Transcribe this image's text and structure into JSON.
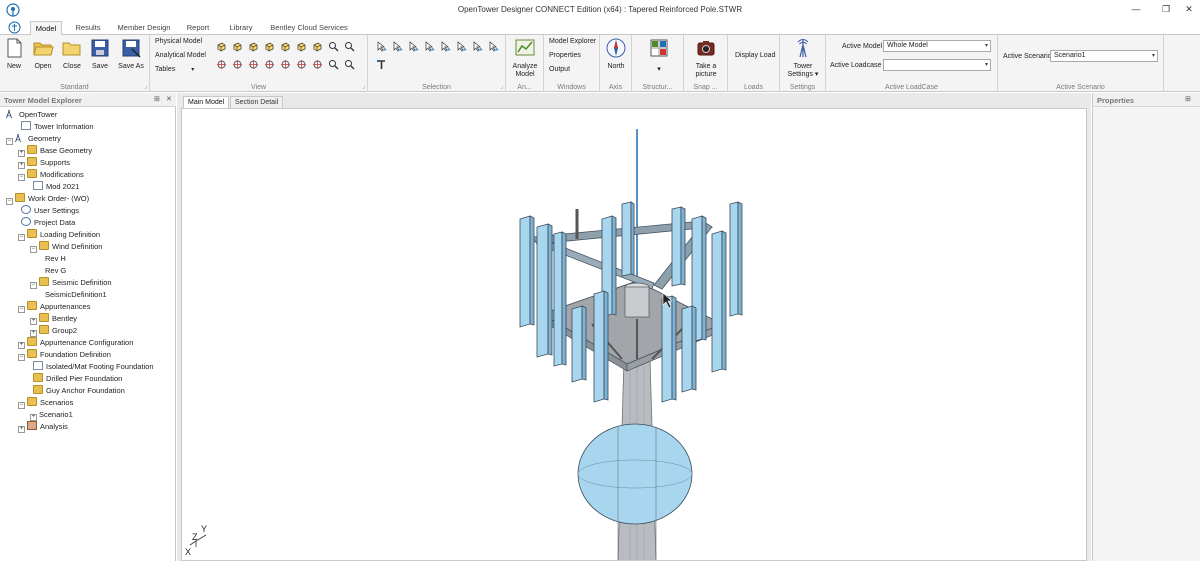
{
  "window": {
    "title": "OpenTower Designer CONNECT Edition (x64) : Tapered Reinforced Pole.STWR",
    "minimize": "—",
    "restore": "❐",
    "close": "✕"
  },
  "ribbon_tabs": [
    "Model",
    "Results",
    "Member Design",
    "Report",
    "Library",
    "Bentley Cloud Services"
  ],
  "standard": {
    "group_label": "Standard",
    "new": "New",
    "open": "Open",
    "close": "Close",
    "save": "Save",
    "save_as": "Save As"
  },
  "view": {
    "group_label": "View",
    "physical_model": "Physical Model",
    "analytical_model": "Analytical Model",
    "tables": "Tables"
  },
  "selection": {
    "group_label": "Selection"
  },
  "analyze": {
    "label": "Analyze Model",
    "group_label": "An..."
  },
  "windows": {
    "group_label": "Windows",
    "model_explorer": "Model Explorer",
    "properties": "Properties",
    "output": "Output"
  },
  "axis": {
    "north": "North",
    "group_label": "Axis"
  },
  "structure": {
    "group_label": "Structur..."
  },
  "snap": {
    "take_picture": "Take a picture",
    "group_label": "Snap ..."
  },
  "loads": {
    "display_load": "Display Load",
    "group_label": "Loads"
  },
  "settings": {
    "tower_settings": "Tower Settings",
    "group_label": "Settings"
  },
  "active_loadcase": {
    "group_label": "Active LoadCase",
    "active_model_label": "Active Model",
    "active_model_value": "Whole Model",
    "active_loadcase_label": "Active Loadcase",
    "active_loadcase_value": ""
  },
  "active_scenario": {
    "group_label": "Active Scenario",
    "label": "Active Scenario",
    "value": "Scenario1"
  },
  "explorer": {
    "title": "Tower Model Explorer",
    "items": [
      {
        "label": "OpenTower"
      },
      {
        "label": "Tower Information"
      },
      {
        "label": "Geometry"
      },
      {
        "label": "Base Geometry"
      },
      {
        "label": "Supports"
      },
      {
        "label": "Modifications"
      },
      {
        "label": "Mod 2021"
      },
      {
        "label": "Work Order- (WO)"
      },
      {
        "label": "User Settings"
      },
      {
        "label": "Project Data"
      },
      {
        "label": "Loading Definition"
      },
      {
        "label": "Wind Definition"
      },
      {
        "label": "Rev H"
      },
      {
        "label": "Rev G"
      },
      {
        "label": "Seismic Definition"
      },
      {
        "label": "SeismicDefinition1"
      },
      {
        "label": "Appurtenances"
      },
      {
        "label": "Bentley"
      },
      {
        "label": "Group2"
      },
      {
        "label": "Appurtenance Configuration"
      },
      {
        "label": "Foundation Definition"
      },
      {
        "label": "Isolated/Mat Footing Foundation"
      },
      {
        "label": "Drilled Pier Foundation"
      },
      {
        "label": "Guy Anchor Foundation"
      },
      {
        "label": "Scenarios"
      },
      {
        "label": "Scenario1"
      },
      {
        "label": "Analysis"
      }
    ]
  },
  "doc_tabs": [
    "Main Model",
    "Section Detail"
  ],
  "properties_panel": {
    "title": "Properties"
  },
  "axis_triad": {
    "y": "Y",
    "z": "Z",
    "x": "X"
  },
  "colors": {
    "accent": "#1d6fb8",
    "tower_fill": "#a9d6ef",
    "tower_stroke": "#3a4a5a",
    "pole": "#b8bcc0"
  }
}
